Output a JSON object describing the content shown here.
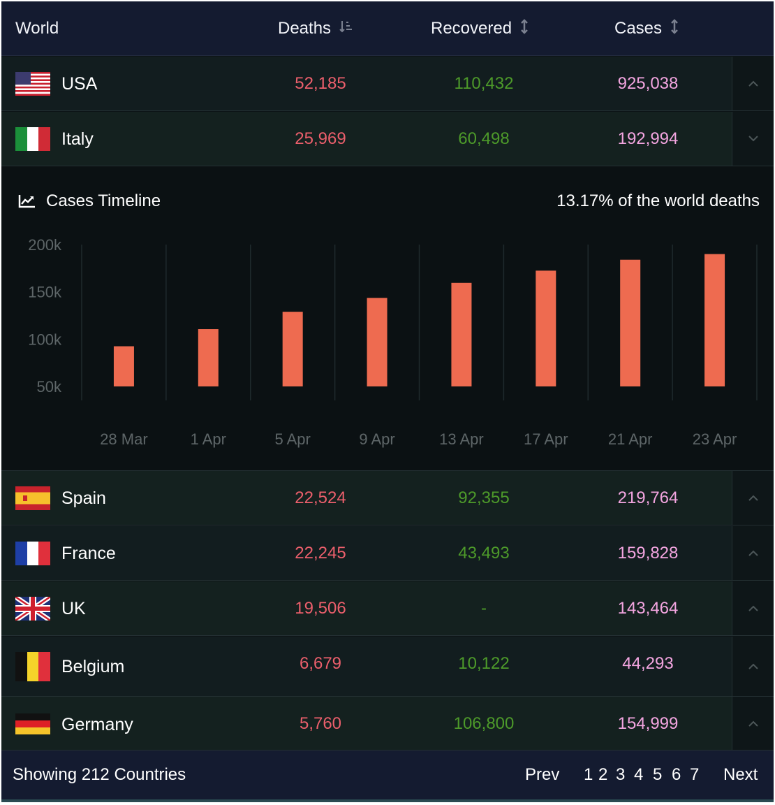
{
  "header": {
    "world": "World",
    "deaths": "Deaths",
    "recovered": "Recovered",
    "cases": "Cases"
  },
  "rows": [
    {
      "country": "USA",
      "deaths": "52,185",
      "recovered": "110,432",
      "cases": "925,038",
      "flag": "usa-flag-icon"
    },
    {
      "country": "Italy",
      "deaths": "25,969",
      "recovered": "60,498",
      "cases": "192,994",
      "flag": "italy-flag-icon"
    },
    {
      "country": "Spain",
      "deaths": "22,524",
      "recovered": "92,355",
      "cases": "219,764",
      "flag": "spain-flag-icon"
    },
    {
      "country": "France",
      "deaths": "22,245",
      "recovered": "43,493",
      "cases": "159,828",
      "flag": "france-flag-icon"
    },
    {
      "country": "UK",
      "deaths": "19,506",
      "recovered": "-",
      "cases": "143,464",
      "flag": "uk-flag-icon"
    },
    {
      "country": "Belgium",
      "deaths": "6,679",
      "recovered": "10,122",
      "cases": "44,293",
      "flag": "belgium-flag-icon"
    },
    {
      "country": "Germany",
      "deaths": "5,760",
      "recovered": "106,800",
      "cases": "154,999",
      "flag": "germany-flag-icon"
    }
  ],
  "panel": {
    "title": "Cases Timeline",
    "stat": "13.17% of the world deaths"
  },
  "chart_data": {
    "type": "bar",
    "categories": [
      "28 Mar",
      "1 Apr",
      "5 Apr",
      "9 Apr",
      "13 Apr",
      "17 Apr",
      "21 Apr",
      "23 Apr"
    ],
    "values": [
      92472,
      110574,
      128948,
      143626,
      159516,
      172434,
      183957,
      189973
    ],
    "yticks": [
      "200k",
      "150k",
      "100k",
      "50k"
    ],
    "ytick_values": [
      200000,
      150000,
      100000,
      50000
    ],
    "ylim": [
      50000,
      200000
    ],
    "grid": true,
    "bar_color": "#ee6b50"
  },
  "footer": {
    "showing": "Showing 212 Countries",
    "prev": "Prev",
    "pages": [
      "1",
      "2",
      "3",
      "4",
      "5",
      "6",
      "7"
    ],
    "next": "Next"
  },
  "colors": {
    "deaths": "#ec5f6c",
    "recovered": "#4d9a2a",
    "cases": "#f3a5e0",
    "header_bg": "#141b30"
  }
}
